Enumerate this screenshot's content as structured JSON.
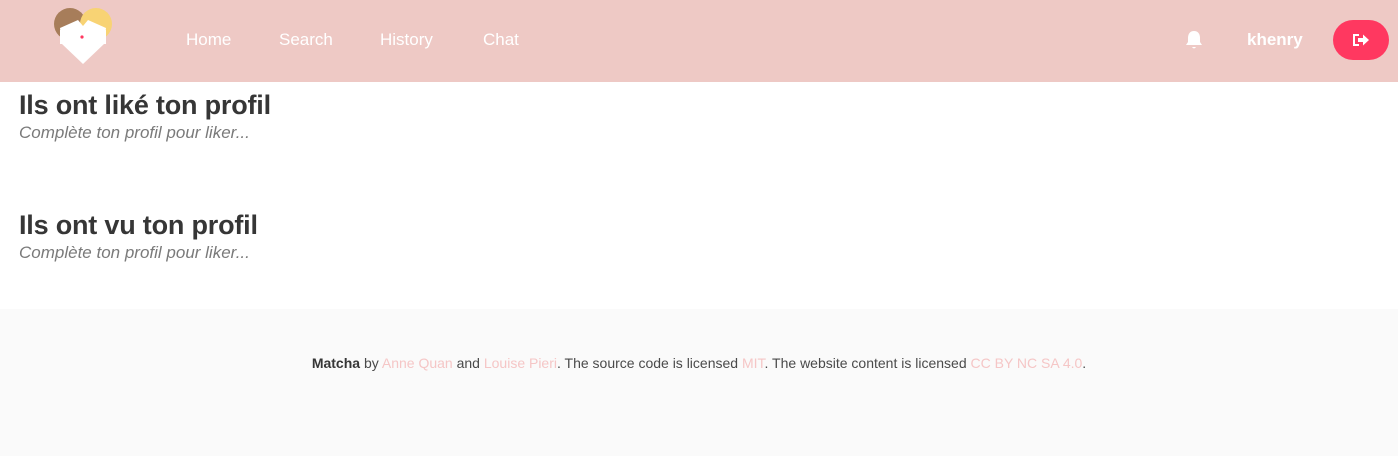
{
  "nav": {
    "links": [
      {
        "label": "Home"
      },
      {
        "label": "Search"
      },
      {
        "label": "History"
      },
      {
        "label": "Chat"
      }
    ],
    "username": "khenry",
    "icons": {
      "logo": "matcha-heart-logo",
      "notifications": "bell-icon",
      "logout": "sign-out-icon"
    }
  },
  "sections": [
    {
      "title": "Ils ont liké ton profil",
      "message": "Complète ton profil pour liker..."
    },
    {
      "title": "Ils ont vu ton profil",
      "message": "Complète ton profil pour liker..."
    }
  ],
  "footer": {
    "brand": "Matcha",
    "by": "by",
    "author1": "Anne Quan",
    "and": "and",
    "author2": "Louise Pieri",
    "code_text": ". The source code is licensed",
    "code_license": "MIT",
    "content_text": ". The website content is licensed",
    "content_license": "CC BY NC SA 4.0",
    "end": "."
  },
  "colors": {
    "navbar": "#eec9c5",
    "logout_button": "#ff3860",
    "footer_link": "#f5c6c6",
    "footer_bg": "#fafafa"
  }
}
